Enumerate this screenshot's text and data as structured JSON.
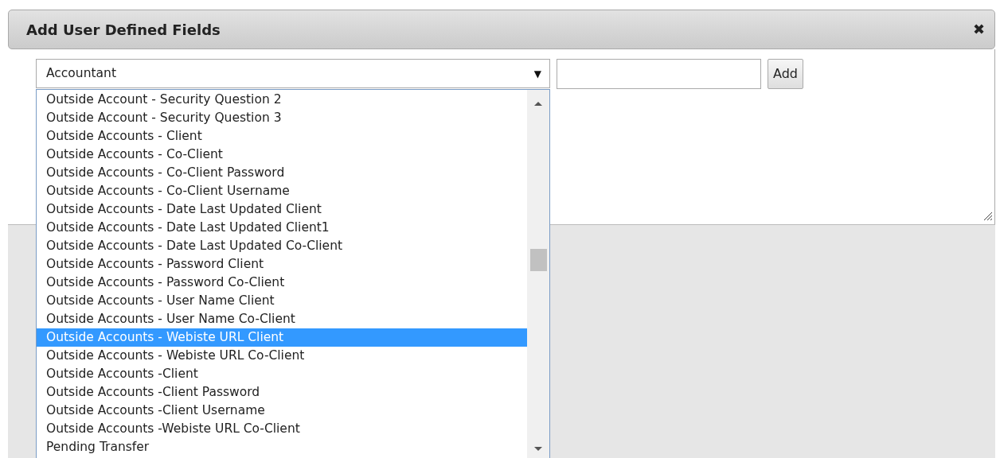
{
  "dialog": {
    "title": "Add User Defined Fields",
    "close": "✖"
  },
  "select": {
    "value": "Accountant",
    "arrow": "▼"
  },
  "add_button": "Add",
  "dropdown": {
    "options": [
      {
        "label": "Outside Account - Security Question 2",
        "selected": false
      },
      {
        "label": "Outside Account - Security Question 3",
        "selected": false
      },
      {
        "label": "Outside Accounts - Client",
        "selected": false
      },
      {
        "label": "Outside Accounts - Co-Client",
        "selected": false
      },
      {
        "label": "Outside Accounts - Co-Client Password",
        "selected": false
      },
      {
        "label": "Outside Accounts - Co-Client Username",
        "selected": false
      },
      {
        "label": "Outside Accounts - Date Last Updated Client",
        "selected": false
      },
      {
        "label": "Outside Accounts - Date Last Updated Client1",
        "selected": false
      },
      {
        "label": "Outside Accounts - Date Last Updated Co-Client",
        "selected": false
      },
      {
        "label": "Outside Accounts - Password Client",
        "selected": false
      },
      {
        "label": "Outside Accounts - Password Co-Client",
        "selected": false
      },
      {
        "label": "Outside Accounts - User Name Client",
        "selected": false
      },
      {
        "label": "Outside Accounts - User Name Co-Client",
        "selected": false
      },
      {
        "label": "Outside Accounts - Webiste URL Client",
        "selected": true
      },
      {
        "label": "Outside Accounts - Webiste URL Co-Client",
        "selected": false
      },
      {
        "label": "Outside Accounts -Client",
        "selected": false
      },
      {
        "label": "Outside Accounts -Client Password",
        "selected": false
      },
      {
        "label": "Outside Accounts -Client Username",
        "selected": false
      },
      {
        "label": "Outside Accounts -Webiste URL Co-Client",
        "selected": false
      },
      {
        "label": "Pending Transfer",
        "selected": false
      }
    ]
  }
}
